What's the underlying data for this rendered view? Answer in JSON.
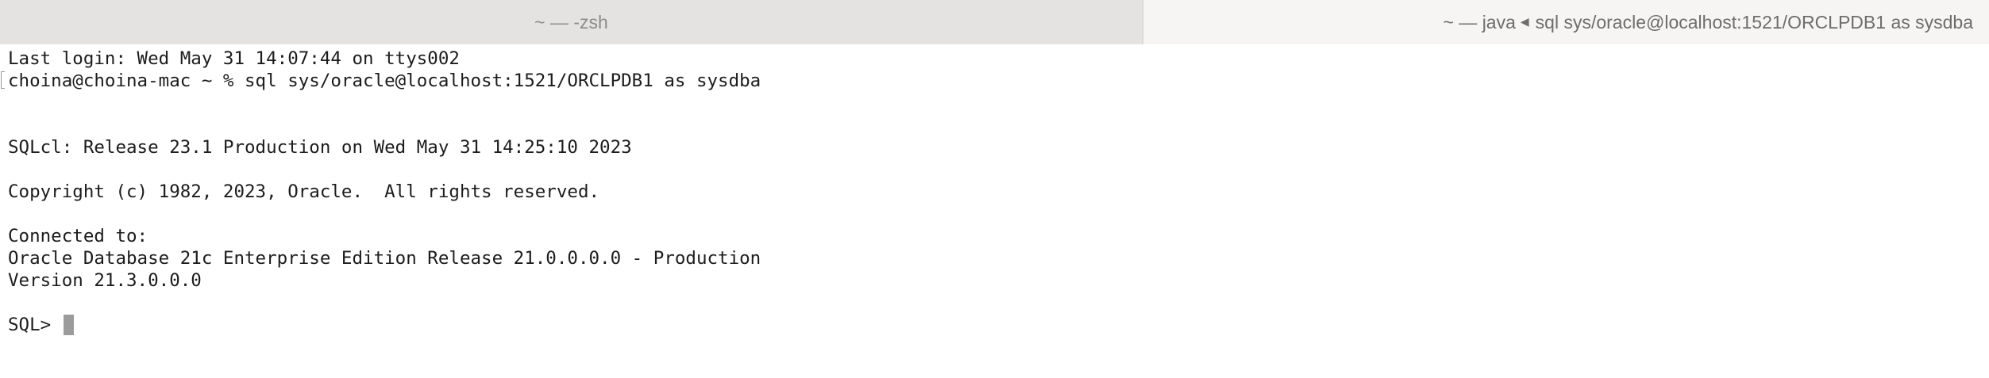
{
  "tabs": [
    {
      "title": "~ — -zsh"
    },
    {
      "title_prefix": "~ — java",
      "title_suffix": "sql sys/oracle@localhost:1521/ORCLPDB1 as sysdba"
    }
  ],
  "terminal": {
    "last_login": "Last login: Wed May 31 14:07:44 on ttys002",
    "command_line": "choina@choina-mac ~ % sql sys/oracle@localhost:1521/ORCLPDB1 as sysdba",
    "release": "SQLcl: Release 23.1 Production on Wed May 31 14:25:10 2023",
    "copyright": "Copyright (c) 1982, 2023, Oracle.  All rights reserved.",
    "connected_to": "Connected to:",
    "database": "Oracle Database 21c Enterprise Edition Release 21.0.0.0.0 - Production",
    "version": "Version 21.3.0.0.0",
    "prompt": "SQL> "
  }
}
